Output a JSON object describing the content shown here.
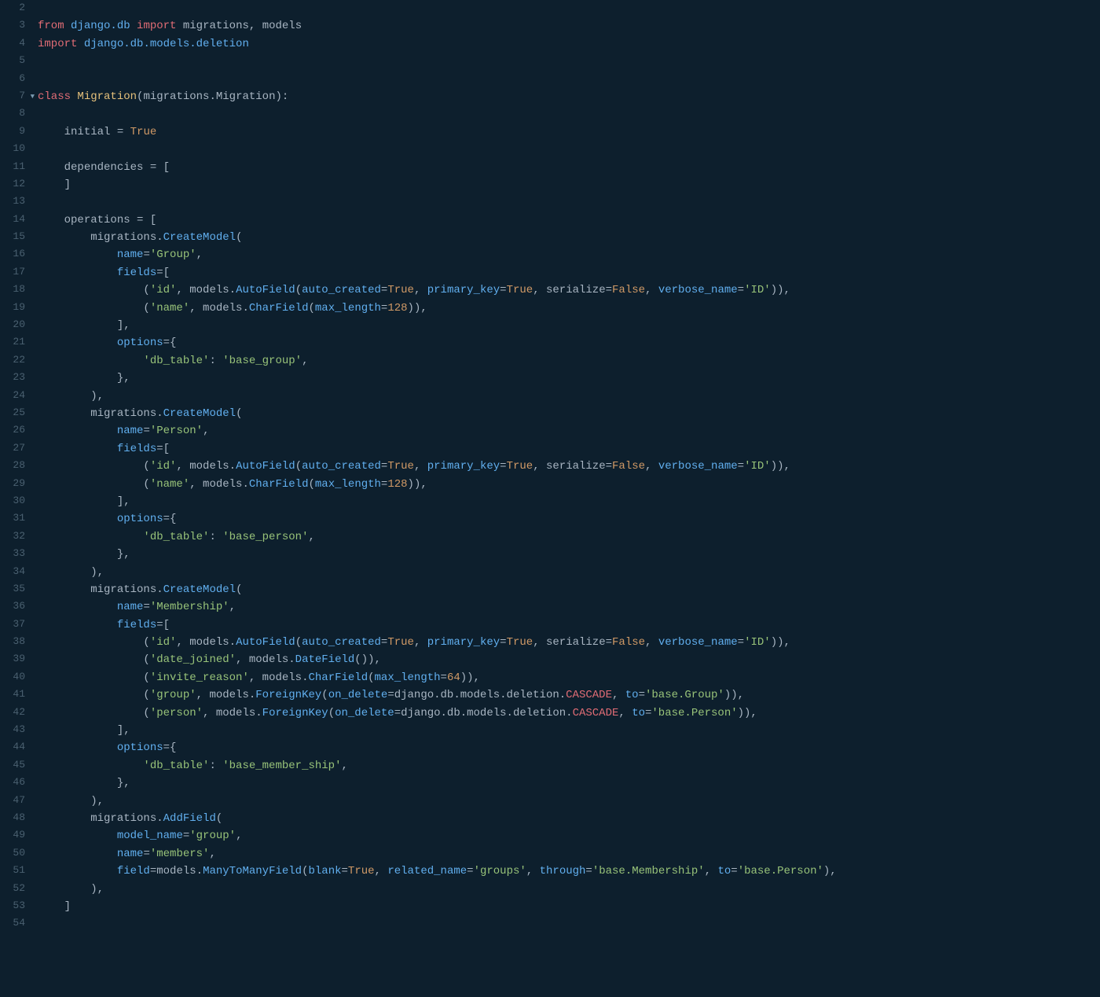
{
  "editor": {
    "background": "#0d1f2d",
    "lines": [
      {
        "num": 2,
        "content": [],
        "arrow": false
      },
      {
        "num": 3,
        "arrow": false
      },
      {
        "num": 4,
        "arrow": false
      },
      {
        "num": 5,
        "content": [],
        "arrow": false
      },
      {
        "num": 6,
        "content": [],
        "arrow": false
      },
      {
        "num": 7,
        "arrow": true
      },
      {
        "num": 8,
        "content": [],
        "arrow": false
      },
      {
        "num": 9,
        "arrow": false
      },
      {
        "num": 10,
        "content": [],
        "arrow": false
      },
      {
        "num": 11,
        "arrow": false
      },
      {
        "num": 12,
        "arrow": false
      },
      {
        "num": 13,
        "content": [],
        "arrow": false
      },
      {
        "num": 14,
        "arrow": false
      },
      {
        "num": 15,
        "arrow": false
      },
      {
        "num": 16,
        "arrow": false
      },
      {
        "num": 17,
        "arrow": false
      },
      {
        "num": 18,
        "arrow": false
      },
      {
        "num": 19,
        "arrow": false
      },
      {
        "num": 20,
        "arrow": false
      },
      {
        "num": 21,
        "arrow": false
      },
      {
        "num": 22,
        "arrow": false
      },
      {
        "num": 23,
        "arrow": false
      },
      {
        "num": 24,
        "arrow": false
      },
      {
        "num": 25,
        "arrow": false
      },
      {
        "num": 26,
        "arrow": false
      },
      {
        "num": 27,
        "arrow": false
      },
      {
        "num": 28,
        "arrow": false
      },
      {
        "num": 29,
        "arrow": false
      },
      {
        "num": 30,
        "arrow": false
      },
      {
        "num": 31,
        "arrow": false
      },
      {
        "num": 32,
        "arrow": false
      },
      {
        "num": 33,
        "arrow": false
      },
      {
        "num": 34,
        "arrow": false
      },
      {
        "num": 35,
        "arrow": false
      },
      {
        "num": 36,
        "arrow": false
      },
      {
        "num": 37,
        "arrow": false
      },
      {
        "num": 38,
        "arrow": false
      },
      {
        "num": 39,
        "arrow": false
      },
      {
        "num": 40,
        "arrow": false
      },
      {
        "num": 41,
        "arrow": false
      },
      {
        "num": 42,
        "arrow": false
      },
      {
        "num": 43,
        "arrow": false
      },
      {
        "num": 44,
        "arrow": false
      },
      {
        "num": 45,
        "arrow": false
      },
      {
        "num": 46,
        "arrow": false
      },
      {
        "num": 47,
        "arrow": false
      },
      {
        "num": 48,
        "arrow": false
      },
      {
        "num": 49,
        "arrow": false
      },
      {
        "num": 50,
        "arrow": false
      },
      {
        "num": 51,
        "arrow": false
      },
      {
        "num": 52,
        "arrow": false
      },
      {
        "num": 53,
        "arrow": false
      },
      {
        "num": 54,
        "content": [],
        "arrow": false
      }
    ]
  }
}
